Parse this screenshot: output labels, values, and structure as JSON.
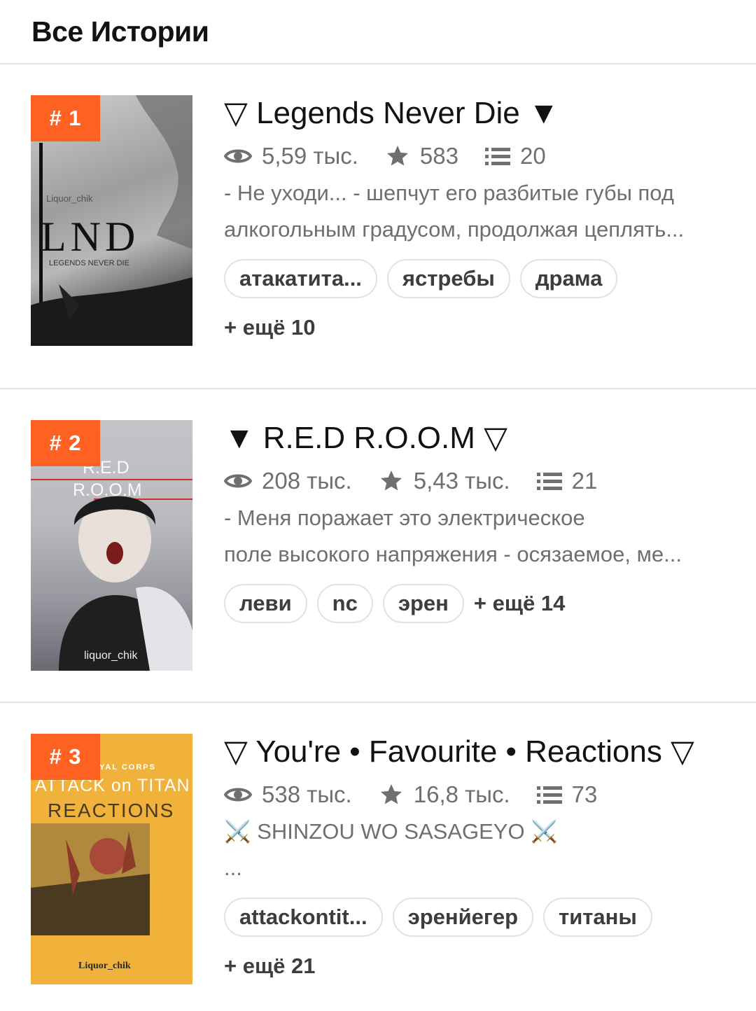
{
  "header": {
    "title": "Все Истории"
  },
  "stories": [
    {
      "rank": "# 1",
      "title": "▽ Legends Never Die ▼",
      "views": "5,59 тыс.",
      "votes": "583",
      "parts": "20",
      "desc_line1": "- Не уходи... - шепчут его разбитые губы под",
      "desc_line2": "алкогольным градусом, продолжая цеплять...",
      "tags": [
        "атакатита...",
        "ястребы",
        "драма"
      ],
      "more": "+ ещё 10",
      "cover": {
        "author": "Liquor_chik",
        "big": "LND",
        "sub": "LEGENDS NEVER DIE"
      }
    },
    {
      "rank": "# 2",
      "title": "▼ R.E.D  R.O.O.M ▽",
      "views": "208 тыс.",
      "votes": "5,43 тыс.",
      "parts": "21",
      "desc_line1": "- Меня поражает это электрическое",
      "desc_line2": "поле высокого напряжения - осязаемое, ме...",
      "tags": [
        "леви",
        "nc",
        "эрен"
      ],
      "more": "+ ещё 14",
      "cover": {
        "line1": "R.E.D",
        "line2": "R.O.O.M",
        "author": "liquor_chik"
      }
    },
    {
      "rank": "# 3",
      "title": "▽ You're • Favourite • Reactions ▽",
      "views": "538 тыс.",
      "votes": "16,8 тыс.",
      "parts": "73",
      "desc_line1": "⚔️ SHINZOU WO SASAGEYO ⚔️",
      "desc_line2": "...",
      "tags": [
        "attackontit...",
        "эренйегер",
        "титаны"
      ],
      "more": "+ ещё 21",
      "cover": {
        "top": "YAL CORPS",
        "line1": "ATTACK on TITAN",
        "line2": "REACTIONS",
        "author": "Liquor_chik"
      }
    }
  ],
  "colors": {
    "accent": "#ff6122",
    "text": "#121212",
    "muted": "#6f6f6f",
    "divider": "#e6e6e6"
  },
  "icons": {
    "views": "eye-icon",
    "votes": "star-icon",
    "parts": "list-icon"
  }
}
